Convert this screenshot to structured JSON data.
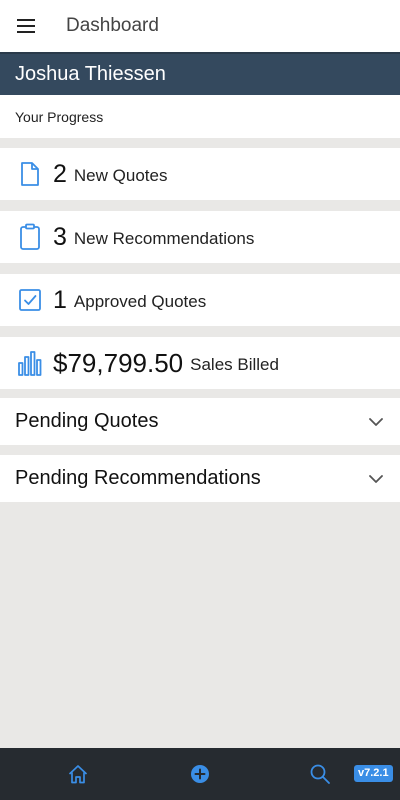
{
  "header": {
    "title": "Dashboard",
    "menu_icon": "hamburger-menu-icon"
  },
  "user": {
    "name": "Joshua Thiessen"
  },
  "progress": {
    "subtitle": "Your Progress"
  },
  "stats": [
    {
      "icon": "document-icon",
      "value": "2",
      "label": "New Quotes"
    },
    {
      "icon": "clipboard-icon",
      "value": "3",
      "label": "New Recommendations"
    },
    {
      "icon": "checkbox-icon",
      "value": "1",
      "label": "Approved Quotes"
    },
    {
      "icon": "bar-chart-icon",
      "value": "$79,799.50",
      "label": "Sales Billed"
    }
  ],
  "sections": [
    {
      "title": "Pending Quotes",
      "icon": "chevron-down-icon"
    },
    {
      "title": "Pending Recommendations",
      "icon": "chevron-down-icon"
    }
  ],
  "bottom_nav": {
    "items": [
      "home-icon",
      "add-circle-icon",
      "search-icon"
    ],
    "version": "v7.2.1"
  },
  "colors": {
    "header_bg": "#34495e",
    "accent": "#3a8ee6",
    "nav_bg": "#262b30",
    "page_bg": "#e9e8e6"
  }
}
